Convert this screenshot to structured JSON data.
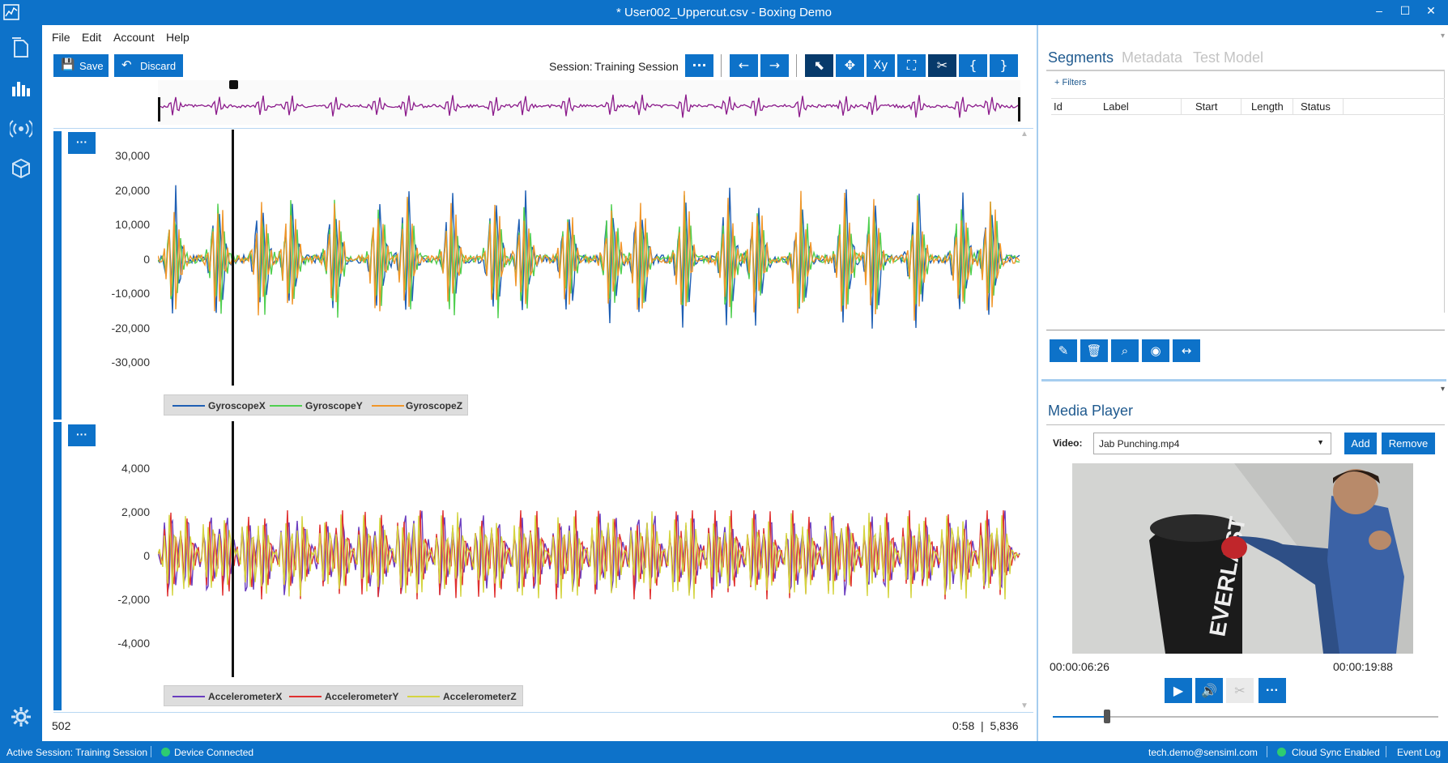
{
  "window": {
    "title": "* User002_Uppercut.csv - Boxing Demo",
    "minimize": "–",
    "maximize": "☐",
    "close": "✕"
  },
  "menu": [
    "File",
    "Edit",
    "Account",
    "Help"
  ],
  "toolbar": {
    "save_label": "Save",
    "discard_label": "Discard",
    "session_label": "Session:",
    "session_value": "Training Session",
    "more_label": "···",
    "buttons": [
      "←",
      "→",
      "⬉",
      "✥",
      "Xy",
      "⛶",
      "✂",
      "{",
      "}"
    ]
  },
  "charts": {
    "gyro": {
      "yticks": [
        "30,000",
        "20,000",
        "10,000",
        "0",
        "-10,000",
        "-20,000",
        "-30,000"
      ],
      "legend": [
        "GyroscopeX",
        "GyroscopeY",
        "GyroscopeZ"
      ],
      "colors": [
        "#1f5fb4",
        "#4fcf4f",
        "#f0962a"
      ]
    },
    "accel": {
      "yticks": [
        "4,000",
        "2,000",
        "0",
        "-2,000",
        "-4,000"
      ],
      "legend": [
        "AccelerometerX",
        "AccelerometerY",
        "AccelerometerZ"
      ],
      "colors": [
        "#6a3dbf",
        "#e03030",
        "#d4d440"
      ]
    },
    "overview_color": "#8b1a8b",
    "more_label": "···"
  },
  "footer_left": "502",
  "footer_right": "0:58  |  5,836",
  "right_panel": {
    "tabs": [
      "Segments",
      "Metadata",
      "Test Model"
    ],
    "filters": "+ Filters",
    "columns": [
      "Id",
      "Label",
      "Start",
      "Length",
      "Status"
    ],
    "media_title": "Media Player",
    "video_label": "Video:",
    "video_value": "Jab Punching.mp4",
    "add_label": "Add",
    "remove_label": "Remove",
    "time_current": "00:00:06:26",
    "time_total": "00:00:19:88",
    "more_label": "···",
    "scrubber_fraction": 0.14
  },
  "status": {
    "active_session": "Active Session:  Training Session",
    "device": "Device Connected",
    "email": "tech.demo@sensiml.com",
    "cloud": "Cloud Sync Enabled",
    "event_log": "Event Log"
  }
}
